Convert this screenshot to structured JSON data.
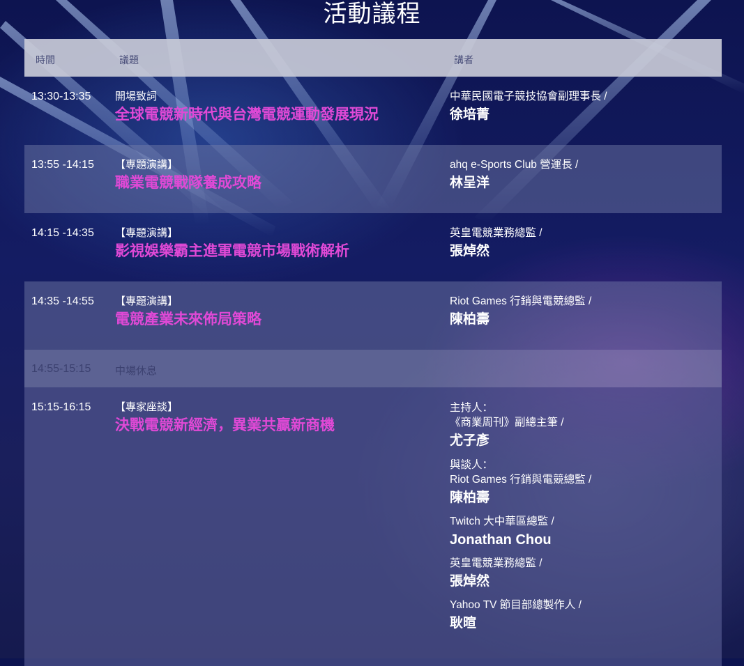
{
  "page_title": "活動議程",
  "header": {
    "time": "時間",
    "topic": "議題",
    "speaker": "講者"
  },
  "sessions": [
    {
      "time": "13:30-13:35",
      "tag": "開場致詞",
      "title": "全球電競新時代與台灣電競運動發展現況",
      "role": "中華民國電子競技協會副理事長 /",
      "name": "徐培菁"
    },
    {
      "time": "13:55 -14:15",
      "tag": "【專題演講】",
      "title": "職業電競戰隊養成攻略",
      "role": "ahq e-Sports Club 營運長 /",
      "name": "林呈洋"
    },
    {
      "time": "14:15 -14:35",
      "tag": "【專題演講】",
      "title": "影視娛樂霸主進軍電競市場戰術解析",
      "role": "英皇電競業務總監 /",
      "name": "張焯然"
    },
    {
      "time": "14:35 -14:55",
      "tag": "【專題演講】",
      "title": "電競產業未來佈局策略",
      "role": "Riot Games 行銷與電競總監 /",
      "name": "陳柏壽"
    }
  ],
  "break": {
    "time": "14:55-15:15",
    "label": "中場休息"
  },
  "panel": {
    "time": "15:15-16:15",
    "tag": "【專家座談】",
    "title": "決戰電競新經濟，異業共贏新商機",
    "host_label": "主持人：",
    "host_role": "《商業周刊》副總主筆 /",
    "host_name": "尤子彥",
    "guest_label": "與談人：",
    "guests": [
      {
        "role": "Riot Games 行銷與電競總監 /",
        "name": "陳柏壽"
      },
      {
        "role": "Twitch 大中華區總監 /",
        "name": "Jonathan Chou"
      },
      {
        "role": "英皇電競業務總監 /",
        "name": "張焯然"
      },
      {
        "role": "Yahoo TV 節目部總製作人 /",
        "name": "耿暄"
      }
    ]
  }
}
